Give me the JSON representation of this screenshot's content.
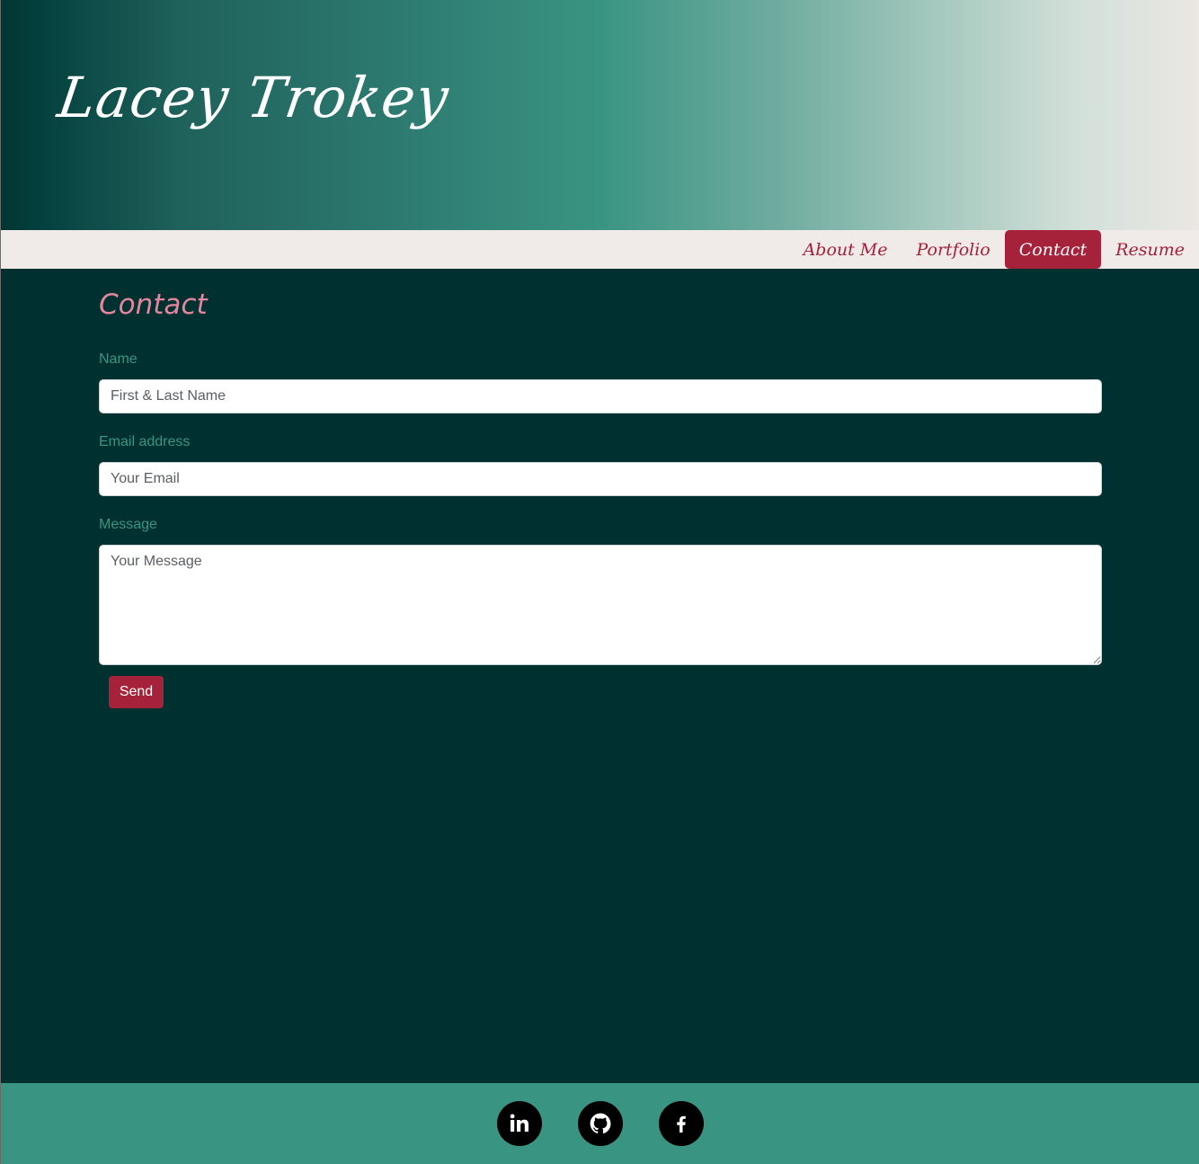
{
  "header": {
    "title": "Lacey Trokey"
  },
  "nav": {
    "items": [
      {
        "label": "About Me"
      },
      {
        "label": "Portfolio"
      },
      {
        "label": "Contact"
      },
      {
        "label": "Resume"
      }
    ],
    "active": "Contact"
  },
  "contact": {
    "heading": "Contact",
    "name_label": "Name",
    "name_placeholder": "First & Last Name",
    "email_label": "Email address",
    "email_placeholder": "Your Email",
    "message_label": "Message",
    "message_placeholder": "Your Message",
    "send_label": "Send"
  },
  "footer": {
    "social": [
      {
        "icon": "linkedin-icon"
      },
      {
        "icon": "github-icon"
      },
      {
        "icon": "facebook-icon"
      }
    ]
  },
  "colors": {
    "accent": "#a6213a",
    "background": "#00302f",
    "teal": "#3a9482",
    "nav_background": "#f0ebe8",
    "heading_pink": "#e3869d"
  }
}
